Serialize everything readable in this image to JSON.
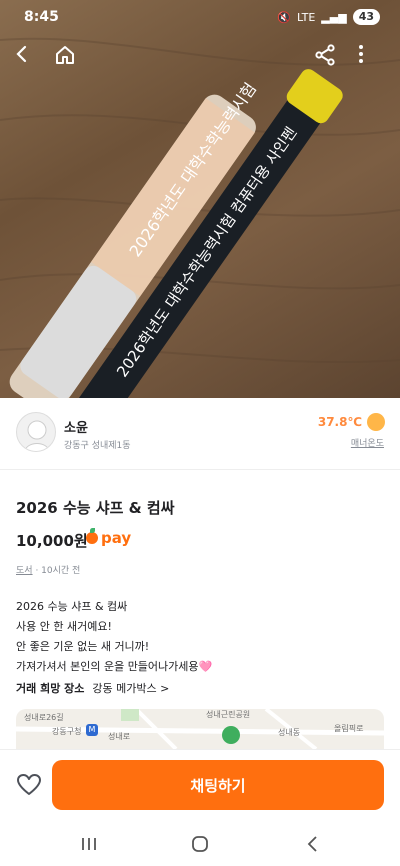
{
  "status": {
    "time": "8:45",
    "network": "LTE",
    "battery": "43"
  },
  "seller": {
    "name": "소윤",
    "location": "강동구 성내제1동",
    "temperature": "37.8℃",
    "temperature_label": "매너온도"
  },
  "listing": {
    "title": "2026 수능 샤프 & 컴싸",
    "price": "10,000원",
    "pay_label": "pay",
    "category": "도서",
    "time_ago": "10시간 전",
    "description": "2026 수능 샤프 & 컴싸\n사용 안 한 새거예요!\n안 좋은 기운 없는 새 거니까!\n가져가셔서 본인의 운을 만들어나가세용🩷"
  },
  "place": {
    "label": "거래 희망 장소",
    "value": "강동 메가박스 >"
  },
  "map": {
    "labels": [
      "성내근린공원",
      "성내로26길",
      "강동구청",
      "성내로",
      "성내동",
      "올림픽로"
    ],
    "metro_badge": "M"
  },
  "actions": {
    "chat_label": "채팅하기"
  },
  "icons": {
    "back": "back-arrow-icon",
    "home": "home-icon",
    "share": "share-icon",
    "more": "more-vertical-icon",
    "heart": "heart-icon"
  },
  "colors": {
    "accent": "#ff6f0f",
    "temperature": "#ff8a3d"
  }
}
